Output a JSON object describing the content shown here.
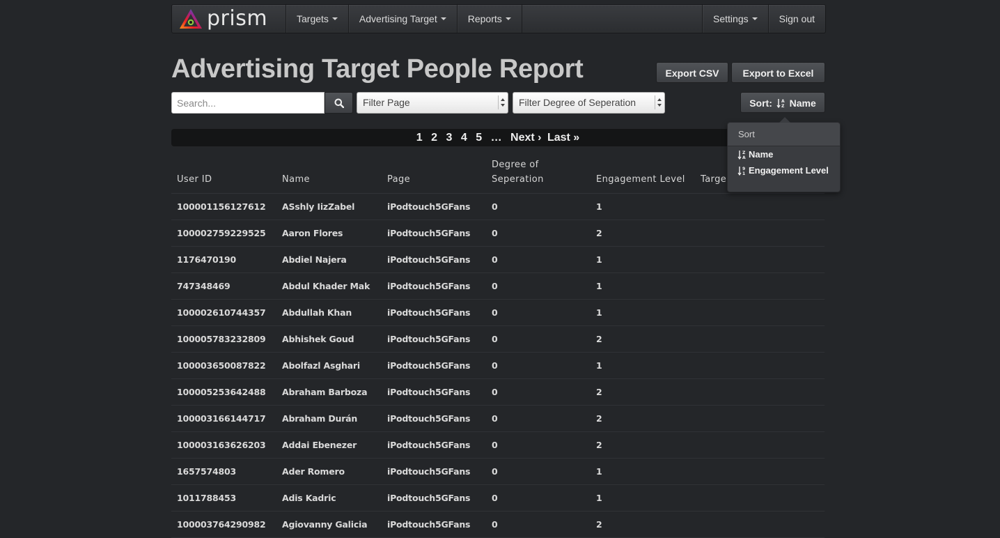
{
  "nav": {
    "brand": "prism",
    "menus": [
      {
        "label": "Targets"
      },
      {
        "label": "Advertising Target"
      },
      {
        "label": "Reports"
      }
    ],
    "settings_label": "Settings",
    "signout_label": "Sign out"
  },
  "page": {
    "title": "Advertising Target People Report"
  },
  "toolbar": {
    "export_csv": "Export CSV",
    "export_excel": "Export to Excel",
    "search_placeholder": "Search...",
    "filter_page": "Filter Page",
    "filter_degree": "Filter Degree of Seperation",
    "sort_prefix": "Sort:",
    "sort_value": "Name"
  },
  "pagination": {
    "pages": [
      "1",
      "2",
      "3",
      "4",
      "5"
    ],
    "ellipsis": "…",
    "next": "Next ›",
    "last": "Last »"
  },
  "sort_menu": {
    "header": "Sort",
    "options": [
      "Name",
      "Engagement Level"
    ]
  },
  "table": {
    "headers": [
      "User ID",
      "Name",
      "Page",
      "Degree of Seperation",
      "Engagement Level",
      "Targe"
    ],
    "rows": [
      [
        "100001156127612",
        "ASshly IizZabel",
        "iPodtouch5GFans",
        "0",
        "1"
      ],
      [
        "100002759229525",
        "Aaron Flores",
        "iPodtouch5GFans",
        "0",
        "2"
      ],
      [
        "1176470190",
        "Abdiel Najera",
        "iPodtouch5GFans",
        "0",
        "1"
      ],
      [
        "747348469",
        "Abdul Khader Mak",
        "iPodtouch5GFans",
        "0",
        "1"
      ],
      [
        "100002610744357",
        "Abdullah Khan",
        "iPodtouch5GFans",
        "0",
        "1"
      ],
      [
        "100005783232809",
        "Abhishek Goud",
        "iPodtouch5GFans",
        "0",
        "2"
      ],
      [
        "100003650087822",
        "Abolfazl Asghari",
        "iPodtouch5GFans",
        "0",
        "1"
      ],
      [
        "100005253642488",
        "Abraham Barboza",
        "iPodtouch5GFans",
        "0",
        "2"
      ],
      [
        "100003166144717",
        "Abraham Durán",
        "iPodtouch5GFans",
        "0",
        "2"
      ],
      [
        "100003163626203",
        "Addai Ebenezer",
        "iPodtouch5GFans",
        "0",
        "2"
      ],
      [
        "1657574803",
        "Ader Romero",
        "iPodtouch5GFans",
        "0",
        "1"
      ],
      [
        "1011788453",
        "Adis Kadric",
        "iPodtouch5GFans",
        "0",
        "1"
      ],
      [
        "100003764290982",
        "Agiovanny Galicia",
        "iPodtouch5GFans",
        "0",
        "2"
      ]
    ]
  }
}
